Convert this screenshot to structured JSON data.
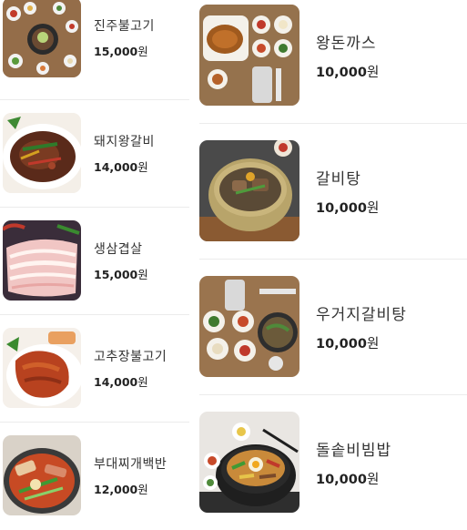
{
  "currency_unit": "원",
  "left_menu": [
    {
      "name": "진주불고기",
      "price": "15,000",
      "image": "bulgogi-table-photo"
    },
    {
      "name": "돼지왕갈비",
      "price": "14,000",
      "image": "braised-pork-ribs-photo"
    },
    {
      "name": "생삼겹살",
      "price": "15,000",
      "image": "raw-pork-belly-photo"
    },
    {
      "name": "고추장불고기",
      "price": "14,000",
      "image": "spicy-pork-bulgogi-photo"
    },
    {
      "name": "부대찌개백반",
      "price": "12,000",
      "image": "budae-jjigae-photo"
    }
  ],
  "right_menu": [
    {
      "name": "왕돈까스",
      "price": "10,000",
      "image": "pork-cutlet-set-photo"
    },
    {
      "name": "갈비탕",
      "price": "10,000",
      "image": "galbitang-bowl-photo"
    },
    {
      "name": "우거지갈비탕",
      "price": "10,000",
      "image": "ugeoji-galbitang-set-photo"
    },
    {
      "name": "돌솥비빔밥",
      "price": "10,000",
      "image": "dolsot-bibimbap-photo"
    }
  ]
}
